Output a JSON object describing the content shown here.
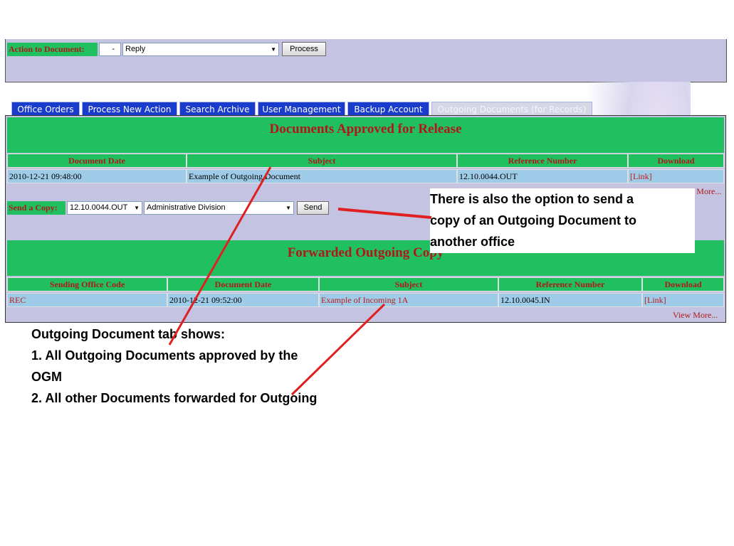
{
  "action_bar": {
    "label": "Action to Document:",
    "small_select": "-",
    "action_select": "Reply",
    "process_button": "Process"
  },
  "tabs": [
    {
      "label": "Office Orders",
      "active": false
    },
    {
      "label": "Process New Action",
      "active": false
    },
    {
      "label": "Search Archive",
      "active": false
    },
    {
      "label": "User Management",
      "active": false
    },
    {
      "label": "Backup Account",
      "active": false
    },
    {
      "label": "Outgoing Documents (for Records)",
      "active": true
    }
  ],
  "approved": {
    "title": "Documents Approved for Release",
    "columns": [
      "Document Date",
      "Subject",
      "Reference Number",
      "Download"
    ],
    "rows": [
      [
        "2010-12-21 09:48:00",
        "Example of Outgoing Document",
        "12.10.0044.OUT",
        "[Link]"
      ]
    ],
    "view_more": "View More..."
  },
  "send_copy": {
    "label": "Send a Copy:",
    "reference_select": "12.10.0044.OUT",
    "office_select": "Administrative Division",
    "send_button": "Send"
  },
  "forwarded": {
    "title": "Forwarded Outgoing Copy",
    "columns": [
      "Sending Office Code",
      "Document Date",
      "Subject",
      "Reference Number",
      "Download"
    ],
    "rows": [
      [
        "REC",
        "2010-12-21 09:52:00",
        "Example of Incoming 1A",
        "12.10.0045.IN",
        "[Link]"
      ]
    ],
    "view_more": "View More..."
  },
  "annotations": {
    "right_note": [
      "There is also the option to send a",
      "copy of an Outgoing Document to",
      "another office"
    ],
    "bottom_note": [
      "Outgoing Document tab shows:",
      "1. All Outgoing Documents approved by the",
      "OGM",
      "2. All other Documents forwarded for Outgoing"
    ]
  },
  "colors": {
    "panel": "#c4c4e2",
    "header_green": "#20c060",
    "header_text": "#b01818",
    "tab_blue": "#1a3ccc",
    "row_blue": "#9ecbe8",
    "arrow_red": "#e02020"
  }
}
